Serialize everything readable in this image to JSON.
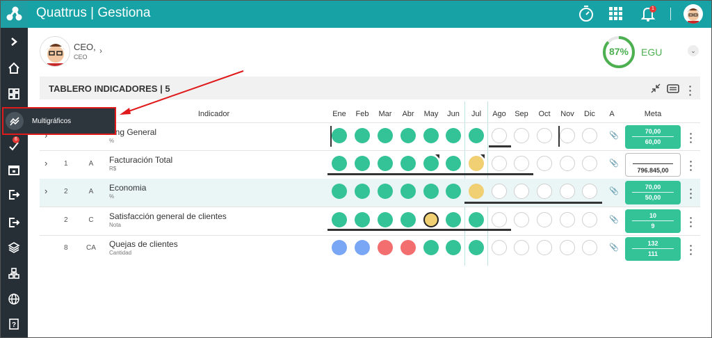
{
  "topbar": {
    "brand": "Quattrus | Gestiona",
    "notification_count": "1"
  },
  "sidebar": {
    "items": [
      "expand",
      "home",
      "dashboard",
      "multigraficos",
      "tasks",
      "calendar",
      "exit",
      "export",
      "layers",
      "org",
      "globe",
      "help"
    ],
    "tasks_badge": "6"
  },
  "tooltip": {
    "label": "Multigráficos"
  },
  "profile": {
    "name": "CEO,",
    "role": "CEO"
  },
  "score": {
    "percent": "87%",
    "unit": "EGU",
    "value": 0.87
  },
  "panel": {
    "title": "TABLERO INDICADORES | 5"
  },
  "table": {
    "headers": {
      "indicador": "Indicador",
      "a": "A",
      "meta": "Meta"
    },
    "months": [
      "Ene",
      "Feb",
      "Mar",
      "Abr",
      "May",
      "Jun",
      "Jul",
      "Ago",
      "Sep",
      "Oct",
      "Nov",
      "Dic"
    ],
    "rows": [
      {
        "num": "",
        "code": "",
        "name": "Saving General",
        "name_visible": "ving General",
        "unit": "%",
        "meta1": "70,00",
        "meta2": "60,00"
      },
      {
        "num": "1",
        "code": "A",
        "name": "Facturación Total",
        "unit": "R$",
        "meta1": "",
        "meta2": "796.845,00"
      },
      {
        "num": "2",
        "code": "A",
        "name": "Economia",
        "unit": "%",
        "meta1": "70,00",
        "meta2": "50,00"
      },
      {
        "num": "2",
        "code": "C",
        "name": "Satisfacción general de clientes",
        "unit": "Nota",
        "meta1": "10",
        "meta2": "9"
      },
      {
        "num": "8",
        "code": "CA",
        "name": "Quejas de clientes",
        "unit": "Cantidad",
        "meta1": "132",
        "meta2": "111"
      }
    ],
    "status": [
      [
        "green",
        "green",
        "green",
        "green",
        "green",
        "green",
        "green",
        "empty",
        "empty",
        "empty",
        "empty",
        "empty"
      ],
      [
        "green",
        "green",
        "green",
        "green",
        "green",
        "green",
        "yellow",
        "empty",
        "empty",
        "empty",
        "empty",
        "empty"
      ],
      [
        "green",
        "green",
        "green",
        "green",
        "green",
        "green",
        "yellow",
        "empty",
        "empty",
        "empty",
        "empty",
        "empty"
      ],
      [
        "green",
        "green",
        "green",
        "green",
        "yellow-ring",
        "green",
        "green",
        "empty",
        "empty",
        "empty",
        "empty",
        "empty"
      ],
      [
        "blue",
        "blue",
        "red",
        "red",
        "green",
        "green",
        "green",
        "empty",
        "empty",
        "empty",
        "empty",
        "empty"
      ]
    ]
  },
  "colors": {
    "topbar": "#17a2a5",
    "sidebar": "#262e36",
    "green": "#33c396",
    "yellow": "#f1cf73",
    "red": "#f36e6e",
    "blue": "#79a7f5",
    "highlight_border": "#e0191b"
  }
}
